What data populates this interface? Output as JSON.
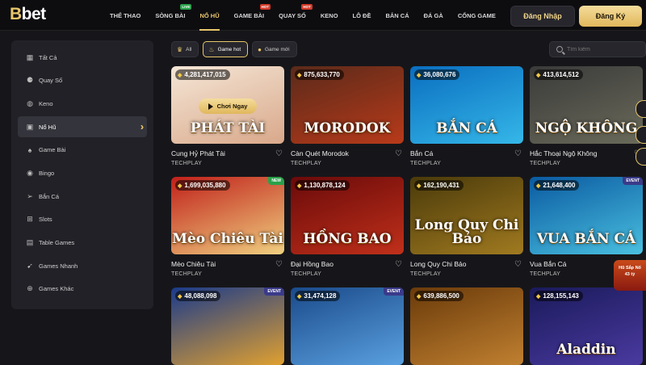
{
  "brand": {
    "logo_prefix": "B",
    "logo_rest": "bet"
  },
  "nav": {
    "items": [
      {
        "label": "THỂ THAO",
        "badge": ""
      },
      {
        "label": "SÒNG BÀI",
        "badge": "LIVE"
      },
      {
        "label": "NỔ HŨ",
        "badge": ""
      },
      {
        "label": "GAME BÀI",
        "badge": "HOT"
      },
      {
        "label": "QUAY SỐ",
        "badge": "HOT"
      },
      {
        "label": "KENO",
        "badge": ""
      },
      {
        "label": "LÔ ĐỀ",
        "badge": ""
      },
      {
        "label": "BẮN CÁ",
        "badge": ""
      },
      {
        "label": "ĐÁ GÀ",
        "badge": ""
      },
      {
        "label": "CỔNG GAME",
        "badge": ""
      }
    ],
    "active_index": 2
  },
  "auth": {
    "login_label": "Đăng Nhập",
    "register_label": "Đăng Ký"
  },
  "sidebar": {
    "items": [
      {
        "label": "Tất Cả",
        "icon": "grid-icon"
      },
      {
        "label": "Quay Số",
        "icon": "balls-icon"
      },
      {
        "label": "Keno",
        "icon": "keno-icon"
      },
      {
        "label": "Nổ Hũ",
        "icon": "slot-machine-icon"
      },
      {
        "label": "Game Bài",
        "icon": "cards-icon"
      },
      {
        "label": "Bingo",
        "icon": "bingo-icon"
      },
      {
        "label": "Bắn Cá",
        "icon": "fish-icon"
      },
      {
        "label": "Slots",
        "icon": "slots-icon"
      },
      {
        "label": "Table Games",
        "icon": "table-icon"
      },
      {
        "label": "Games Nhanh",
        "icon": "rocket-icon"
      },
      {
        "label": "Games Khác",
        "icon": "more-icon"
      }
    ],
    "active_index": 3
  },
  "filters": {
    "chips": [
      {
        "label": "All",
        "icon": "crown-icon"
      },
      {
        "label": "Game hot",
        "icon": "flame-icon"
      },
      {
        "label": "Game mới",
        "icon": "new-icon"
      }
    ],
    "active_index": 1
  },
  "search": {
    "placeholder": "Tìm kiếm"
  },
  "games": [
    {
      "name": "Cung Hỷ Phát Tài",
      "provider": "TECHPLAY",
      "jackpot": "4,281,417,015",
      "tag": "",
      "art": "PHÁT TÀI",
      "play_label": "Chơi Ngay",
      "colors": [
        "#f4e6d6",
        "#d9a88a"
      ]
    },
    {
      "name": "Càn Quét Morodok",
      "provider": "TECHPLAY",
      "jackpot": "875,633,770",
      "tag": "",
      "art": "MORODOK",
      "colors": [
        "#5a2a1a",
        "#b83a1a"
      ]
    },
    {
      "name": "Bắn Cá",
      "provider": "TECHPLAY",
      "jackpot": "36,080,676",
      "tag": "",
      "art": "BẮN CÁ",
      "colors": [
        "#0a6ec0",
        "#35b7e8"
      ]
    },
    {
      "name": "Hắc Thoại Ngộ Không",
      "provider": "TECHPLAY",
      "jackpot": "413,614,512",
      "tag": "",
      "art": "NGỘ KHÔNG",
      "colors": [
        "#3a3a3a",
        "#6a6a5a"
      ]
    },
    {
      "name": "Mèo Chiêu Tài",
      "provider": "TECHPLAY",
      "jackpot": "1,699,035,880",
      "tag": "NEW",
      "art": "Mèo Chiêu Tài",
      "colors": [
        "#c0201a",
        "#f0d080"
      ]
    },
    {
      "name": "Đại Hồng Bao",
      "provider": "TECHPLAY",
      "jackpot": "1,130,878,124",
      "tag": "",
      "art": "HỒNG BAO",
      "colors": [
        "#6a0a0a",
        "#c0301a"
      ]
    },
    {
      "name": "Long Quy Chi Bảo",
      "provider": "TECHPLAY",
      "jackpot": "162,190,431",
      "tag": "",
      "art": "Long Quy Chi Bảo",
      "colors": [
        "#4a3a0a",
        "#a07a20"
      ]
    },
    {
      "name": "Vua Bắn Cá",
      "provider": "TECHPLAY",
      "jackpot": "21,648,400",
      "tag": "EVENT",
      "art": "VUA BẮN CÁ",
      "colors": [
        "#0a5aa0",
        "#4ac0e0"
      ]
    },
    {
      "name": "",
      "provider": "",
      "jackpot": "48,088,098",
      "tag": "EVENT",
      "art": "",
      "colors": [
        "#1a3a8a",
        "#e0a030"
      ]
    },
    {
      "name": "",
      "provider": "",
      "jackpot": "31,474,128",
      "tag": "EVENT",
      "art": "",
      "colors": [
        "#1a4a8a",
        "#5aa0e0"
      ]
    },
    {
      "name": "",
      "provider": "",
      "jackpot": "639,886,500",
      "tag": "",
      "art": "",
      "colors": [
        "#6a3a0a",
        "#c08030"
      ]
    },
    {
      "name": "",
      "provider": "",
      "jackpot": "128,155,143",
      "tag": "",
      "art": "Aladdin",
      "colors": [
        "#1a1a5a",
        "#4a3aa0"
      ]
    }
  ],
  "promo": {
    "line1": "Hũ Sắp Nổ",
    "line2": "43 tỷ"
  }
}
